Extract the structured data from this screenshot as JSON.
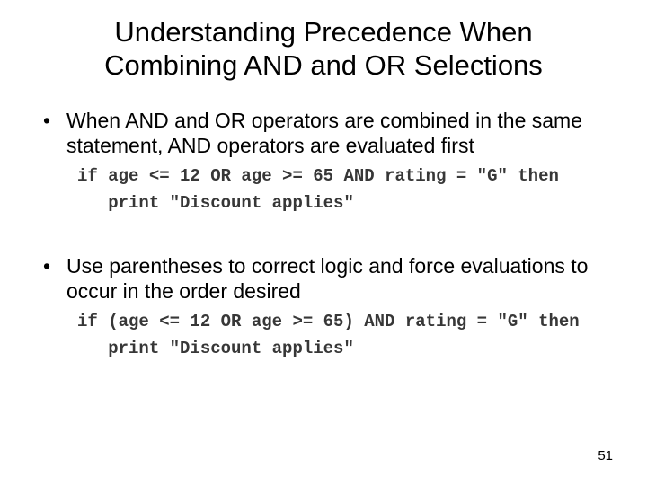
{
  "title_line1": "Understanding Precedence When",
  "title_line2": "Combining AND and OR Selections",
  "bullet1": "When AND and OR operators are combined in the same statement, AND operators are evaluated first",
  "code1_line1": "if age <= 12 OR age >= 65 AND rating = \"G\" then",
  "code1_line2": "   print \"Discount applies\"",
  "bullet2": "Use parentheses to correct logic and force evaluations to occur in the order desired",
  "code2_line1": "if (age <= 12 OR age >= 65) AND rating = \"G\" then",
  "code2_line2": "   print \"Discount applies\"",
  "page_number": "51"
}
